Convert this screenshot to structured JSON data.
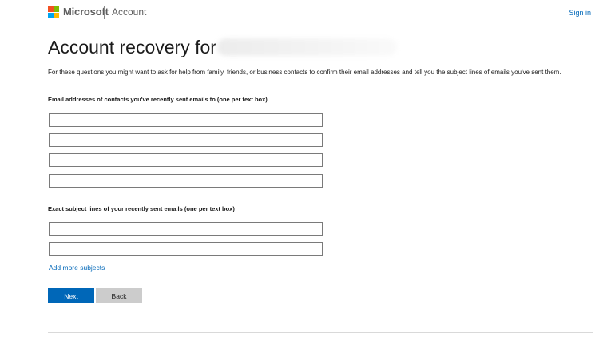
{
  "header": {
    "brand": "Microsoft",
    "section": "Account",
    "signin_label": "Sign in",
    "logo_colors": [
      "#f25022",
      "#7fba00",
      "#00a4ef",
      "#ffb900"
    ]
  },
  "main": {
    "title": "Account recovery for",
    "intro": "For these questions you might want to ask for help from family, friends, or business contacts to confirm their email addresses and tell you the subject lines of emails you've sent them.",
    "contacts_label": "Email addresses of contacts you've recently sent emails to (one per text box)",
    "contacts": [
      "",
      "",
      "",
      ""
    ],
    "subjects_label": "Exact subject lines of your recently sent emails (one per text box)",
    "subjects": [
      "",
      ""
    ],
    "add_more_label": "Add more subjects",
    "next_label": "Next",
    "back_label": "Back"
  },
  "colors": {
    "accent": "#0067b8",
    "secondary_button": "#cccccc"
  }
}
